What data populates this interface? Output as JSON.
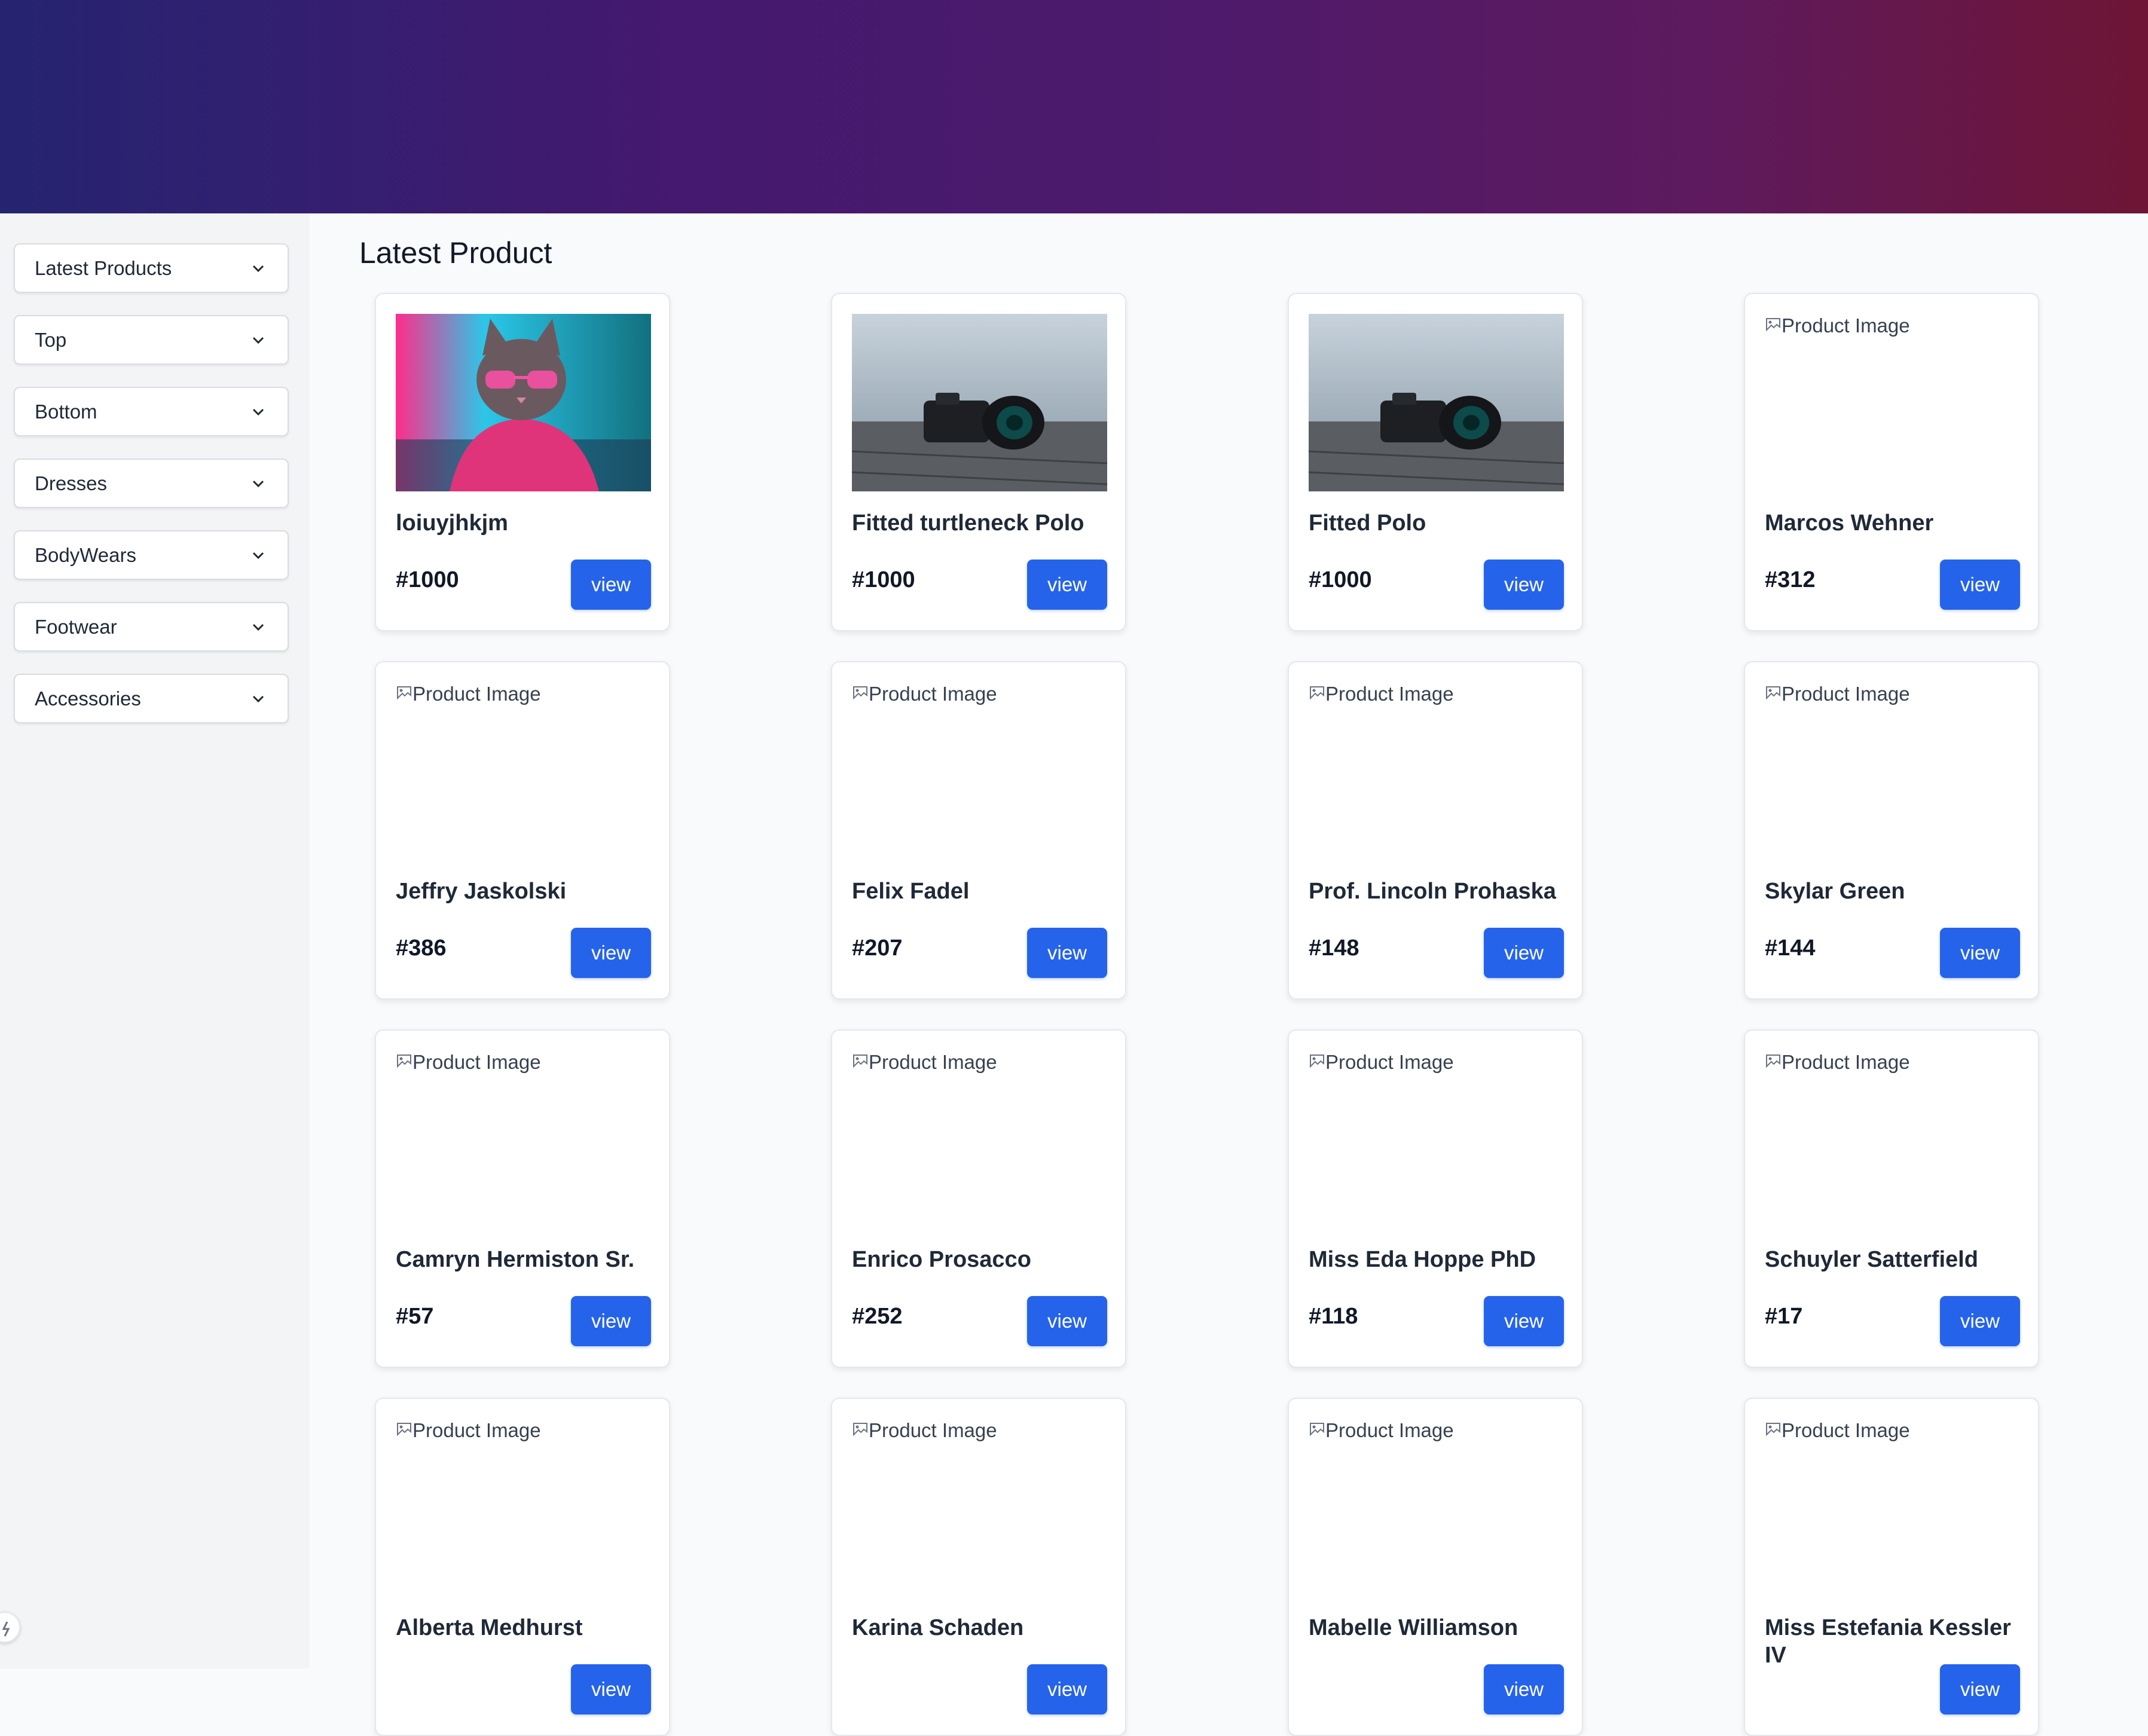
{
  "sidebar": {
    "items": [
      {
        "label": "Latest Products"
      },
      {
        "label": "Top"
      },
      {
        "label": "Bottom"
      },
      {
        "label": "Dresses"
      },
      {
        "label": "BodyWears"
      },
      {
        "label": "Footwear"
      },
      {
        "label": "Accessories"
      }
    ]
  },
  "main": {
    "title": "Latest Product",
    "view_label": "view",
    "image_alt": "Product Image",
    "products": [
      {
        "name": "loiuyjhkjm",
        "number": "#1000",
        "image": "cat-photo"
      },
      {
        "name": "Fitted turtleneck Polo",
        "number": "#1000",
        "image": "camera-photo"
      },
      {
        "name": "Fitted Polo",
        "number": "#1000",
        "image": "camera-photo"
      },
      {
        "name": "Marcos Wehner",
        "number": "#312",
        "image": "broken"
      },
      {
        "name": "Jeffry Jaskolski",
        "number": "#386",
        "image": "broken"
      },
      {
        "name": "Felix Fadel",
        "number": "#207",
        "image": "broken"
      },
      {
        "name": "Prof. Lincoln Prohaska",
        "number": "#148",
        "image": "broken"
      },
      {
        "name": "Skylar Green",
        "number": "#144",
        "image": "broken"
      },
      {
        "name": "Camryn Hermiston Sr.",
        "number": "#57",
        "image": "broken"
      },
      {
        "name": "Enrico Prosacco",
        "number": "#252",
        "image": "broken"
      },
      {
        "name": "Miss Eda Hoppe PhD",
        "number": "#118",
        "image": "broken"
      },
      {
        "name": "Schuyler Satterfield",
        "number": "#17",
        "image": "broken"
      },
      {
        "name": "Alberta Medhurst",
        "number": "",
        "image": "broken"
      },
      {
        "name": "Karina Schaden",
        "number": "",
        "image": "broken"
      },
      {
        "name": "Mabelle Williamson",
        "number": "",
        "image": "broken"
      },
      {
        "name": "Miss Estefania Kessler IV",
        "number": "",
        "image": "broken"
      }
    ]
  },
  "colors": {
    "header_gradient": [
      "#252470",
      "#43196f",
      "#5e1a5d",
      "#6e1535"
    ],
    "accent": "#2563eb",
    "sidebar_bg": "#f3f4f6",
    "page_bg": "#f9fafb"
  }
}
